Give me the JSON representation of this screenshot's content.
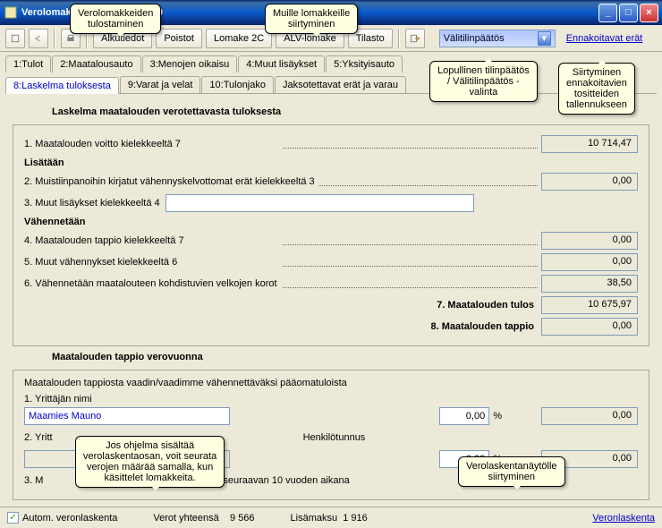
{
  "window": {
    "title": "Verolomake 2004, tiedot v. 200"
  },
  "balloons": {
    "print": "Verolomakkeiden\ntulostaminen",
    "forms": "Muille lomakkeille\nsiirtyminen",
    "dropdown": "Lopullinen tilinpäätös\n/ Välitilinpäätös -\nvalinta",
    "ennak": "Siirtyminen\nennakoitavien\ntositteiden\ntallennukseen",
    "verolask_info": "Jos ohjelma sisältää\nverolaskentaosan, voit seurata\nverojen määrää samalla, kun\nkäsittelet lomakkeita.",
    "verolask_link": "Verolaskentanäytölle\nsiirtyminen"
  },
  "toolbar": {
    "buttons": [
      "Alkutiedot",
      "Poistot",
      "Lomake 2C",
      "ALV-lomake",
      "Tilasto"
    ],
    "dropdown_value": "Välitilinpäätös",
    "link": "Ennakoitavat erät"
  },
  "tabs_row1": [
    "1:Tulot",
    "2:Maatalousauto",
    "3:Menojen oikaisu",
    "4:Muut lisäykset",
    "5:Yksityisauto"
  ],
  "tabs_row2": [
    "8:Laskelma tuloksesta",
    "9:Varat ja velat",
    "10:Tulonjako",
    "Jaksotettavat erät ja varau"
  ],
  "section1": {
    "title": "Laskelma maatalouden verotettavasta tuloksesta",
    "r1": {
      "label": "1. Maatalouden voitto kielekkeeltä 7",
      "value": "10 714,47"
    },
    "lisataan": "Lisätään",
    "r2": {
      "label": "2. Muistiinpanoihin kirjatut vähennyskelvottomat erät kielekkeeltä 3",
      "value": "0,00"
    },
    "r3": {
      "label": "3. Muut lisäykset kielekkeeltä 4",
      "input": ""
    },
    "vahennetaan": "Vähennetään",
    "r4": {
      "label": "4. Maatalouden tappio kielekkeeltä 7",
      "value": "0,00"
    },
    "r5": {
      "label": "5. Muut vähennykset kielekkeeltä 6",
      "value": "0,00"
    },
    "r6": {
      "label": "6. Vähennetään maatalouteen kohdistuvien velkojen korot",
      "value": "38,50"
    },
    "r7": {
      "label": "7. Maatalouden tulos",
      "value": "10 675,97"
    },
    "r8": {
      "label": "8. Maatalouden tappio",
      "value": "0,00"
    }
  },
  "section2": {
    "title": "Maatalouden tappio verovuonna",
    "intro": "Maatalouden tappiosta vaadin/vaadimme vähennettäväksi pääomatuloista",
    "y1_label": "1. Yrittäjän nimi",
    "y1_name": "Maamies Mauno",
    "y1_pct": "0,00",
    "y1_val": "0,00",
    "y2_label": "2. Yritt",
    "henk_label": "Henkilötunnus",
    "y2_pct": "0,00",
    "y2_val": "0,00",
    "r3_suffix": "si seuraavan 10 vuoden aikana",
    "r3_prefix": "3. M"
  },
  "status": {
    "check_label": "Autom. veronlaskenta",
    "verot_label": "Verot yhteensä",
    "verot_val": "9 566",
    "lisam_label": "Lisämaksu",
    "lisam_val": "1 916",
    "link": "Veronlaskenta"
  }
}
